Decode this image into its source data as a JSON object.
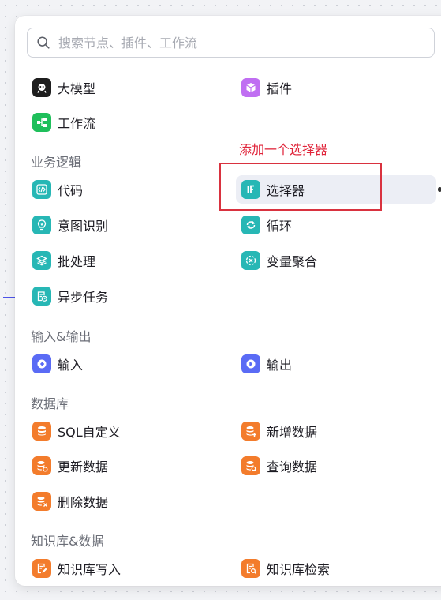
{
  "search": {
    "placeholder": "搜索节点、插件、工作流"
  },
  "colors": {
    "black": "#1e1e1e",
    "purple": "#c06ef2",
    "green": "#1fbf5b",
    "teal": "#27b7b5",
    "blue": "#5a6bf5",
    "orange": "#f37c2c",
    "annotation": "#e0243a"
  },
  "top_items": [
    {
      "label": "大模型",
      "icon": "model-icon"
    },
    {
      "label": "插件",
      "icon": "plugin-cube-icon"
    },
    {
      "label": "工作流",
      "icon": "workflow-icon"
    }
  ],
  "sections": {
    "logic": {
      "title": "业务逻辑",
      "items": [
        {
          "label": "代码",
          "icon": "code-icon"
        },
        {
          "label": "选择器",
          "icon": "if-icon"
        },
        {
          "label": "意图识别",
          "icon": "intent-icon"
        },
        {
          "label": "循环",
          "icon": "loop-icon"
        },
        {
          "label": "批处理",
          "icon": "batch-icon"
        },
        {
          "label": "变量聚合",
          "icon": "aggregate-icon"
        },
        {
          "label": "异步任务",
          "icon": "async-task-icon"
        }
      ]
    },
    "io": {
      "title": "输入&输出",
      "items": [
        {
          "label": "输入",
          "icon": "input-icon"
        },
        {
          "label": "输出",
          "icon": "output-icon"
        }
      ]
    },
    "db": {
      "title": "数据库",
      "items": [
        {
          "label": "SQL自定义",
          "icon": "database-sql-icon"
        },
        {
          "label": "新增数据",
          "icon": "database-add-icon"
        },
        {
          "label": "更新数据",
          "icon": "database-update-icon"
        },
        {
          "label": "查询数据",
          "icon": "database-search-icon"
        },
        {
          "label": "删除数据",
          "icon": "database-delete-icon"
        }
      ]
    },
    "kb": {
      "title": "知识库&数据",
      "items": [
        {
          "label": "知识库写入",
          "icon": "knowledge-write-icon"
        },
        {
          "label": "知识库检索",
          "icon": "knowledge-search-icon"
        }
      ]
    }
  },
  "annotation": {
    "text": "添加一个选择器"
  }
}
